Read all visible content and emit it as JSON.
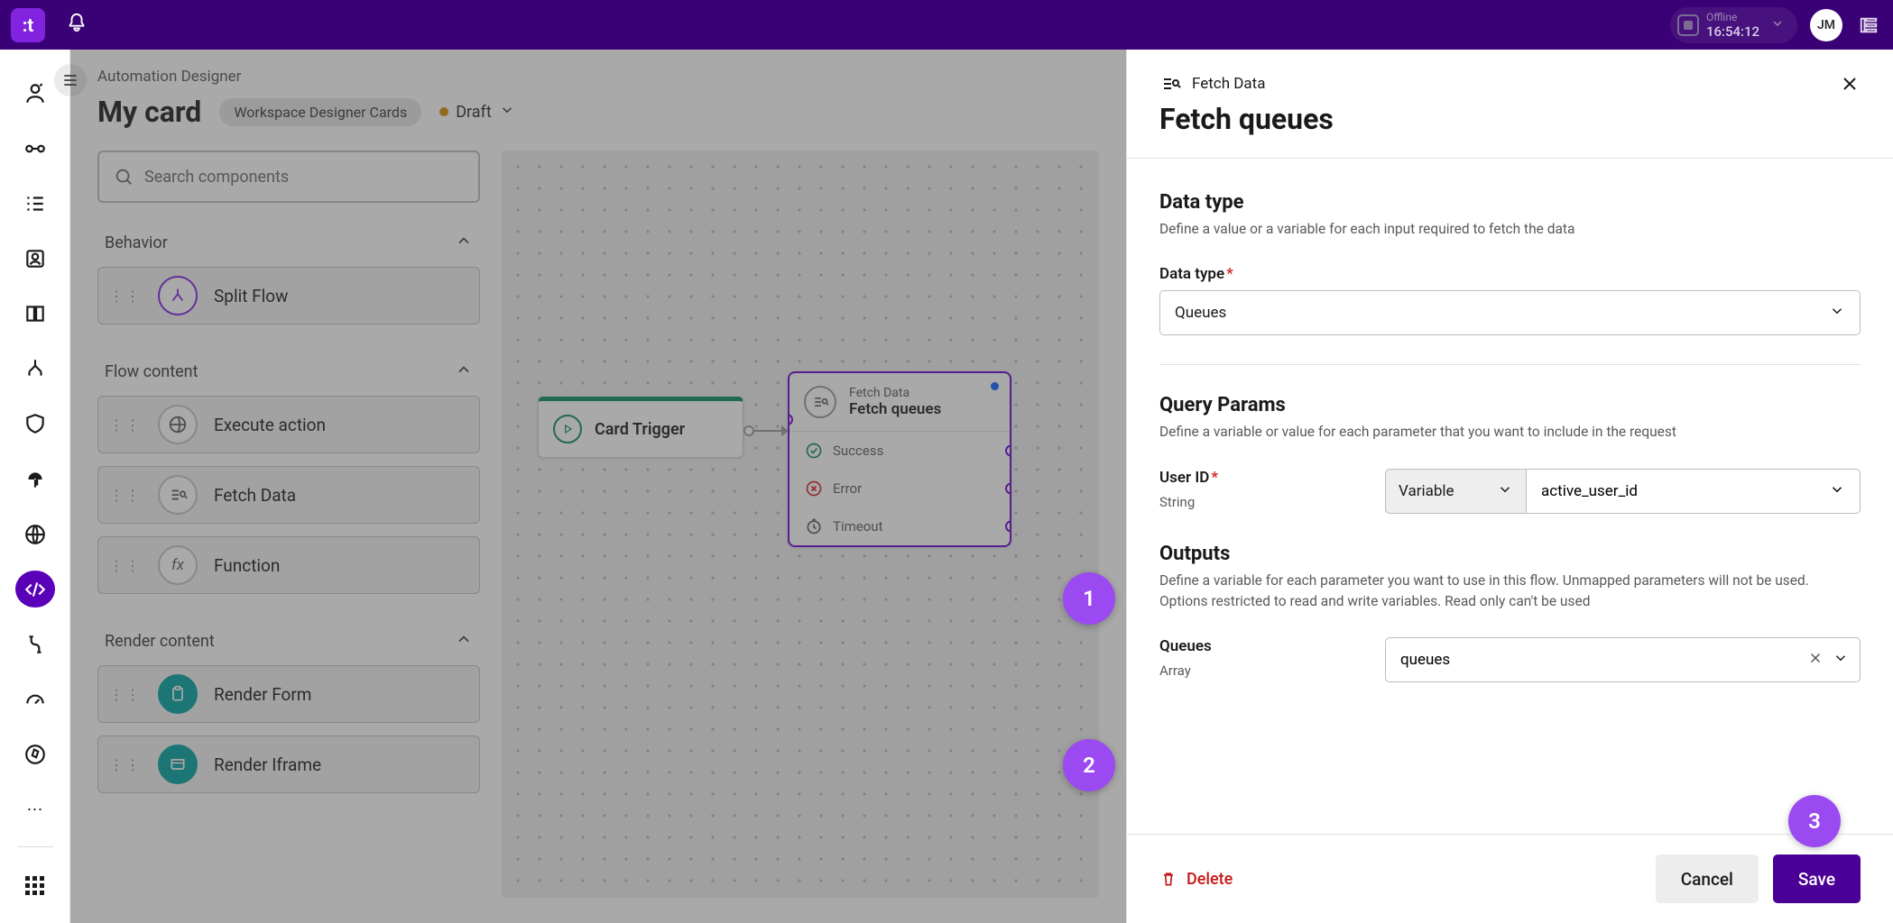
{
  "topbar": {
    "logo_text": ":t",
    "status_label": "Offline",
    "status_time": "16:54:12",
    "avatar_initials": "JM"
  },
  "page": {
    "breadcrumb": "Automation Designer",
    "title": "My card",
    "chip": "Workspace Designer Cards",
    "status": "Draft"
  },
  "search": {
    "placeholder": "Search components"
  },
  "sections": {
    "behavior": "Behavior",
    "flow_content": "Flow content",
    "render_content": "Render content"
  },
  "components": {
    "split_flow": "Split Flow",
    "execute_action": "Execute action",
    "fetch_data": "Fetch Data",
    "function": "Function",
    "render_form": "Render Form",
    "render_iframe": "Render Iframe"
  },
  "canvas": {
    "trigger": "Card Trigger",
    "fetch": {
      "type": "Fetch Data",
      "title": "Fetch queues",
      "success": "Success",
      "error": "Error",
      "timeout": "Timeout"
    }
  },
  "callouts": {
    "one": "1",
    "two": "2",
    "three": "3"
  },
  "panel": {
    "header_type": "Fetch Data",
    "header_title": "Fetch queues",
    "data_type": {
      "title": "Data type",
      "desc": "Define a value or a variable for each input required to fetch the data",
      "field_label": "Data type",
      "value": "Queues"
    },
    "query": {
      "title": "Query Params",
      "desc": "Define a variable or value for each parameter that you want to include in the request",
      "user_id_label": "User ID",
      "user_id_type": "String",
      "variable_label": "Variable",
      "user_id_value": "active_user_id"
    },
    "outputs": {
      "title": "Outputs",
      "desc": "Define a variable for each parameter you want to use in this flow. Unmapped parameters will not be used. Options restricted to read and write variables. Read only can't be used",
      "queues_label": "Queues",
      "queues_type": "Array",
      "queues_value": "queues"
    },
    "footer": {
      "delete": "Delete",
      "cancel": "Cancel",
      "save": "Save"
    }
  }
}
